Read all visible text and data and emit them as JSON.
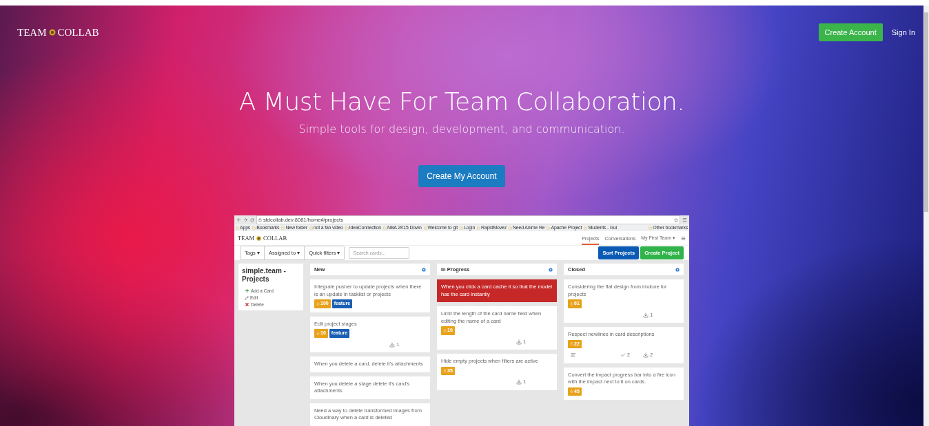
{
  "nav": {
    "logo_left": "TEAM",
    "logo_right": "COLLAB",
    "buttons": [
      {
        "label": "Create Account",
        "kind": "primary"
      },
      {
        "label": "Sign In",
        "kind": "link"
      }
    ]
  },
  "hero": {
    "title": "A Must Have For Team Collaboration.",
    "subtitle": "Simple tools for design, development, and communication.",
    "cta": "Create My Account"
  },
  "preview": {
    "url": "stdcollab.dev:8081/home#/projects",
    "bookmarks": [
      "Apps",
      "Bookmarks",
      "New folder",
      "not a fan video",
      "IdeaConnection",
      "NBA 2K15 Down",
      "Welcome to git",
      "Login",
      "RapidMovez",
      "Need Anime Re",
      "Apache Project",
      "Students - Gui"
    ],
    "other_bookmarks": "Other bookmarks",
    "app": {
      "logo_left": "TEAM",
      "logo_right": "COLLAB",
      "tabs": [
        {
          "label": "Projects",
          "selected": true
        },
        {
          "label": "Conversations",
          "selected": false
        },
        {
          "label": "My First Team ▾",
          "selected": false
        }
      ],
      "filters": [
        "Tags ▾",
        "Assigned to ▾",
        "Quick filters ▾"
      ],
      "search": {
        "placeholder": "Search cards..."
      },
      "buttons": [
        {
          "label": "Sort Projects",
          "kind": "primary"
        },
        {
          "label": "Create Project",
          "kind": "success"
        }
      ],
      "sidebar": {
        "title": "simple.team - Projects",
        "actions": [
          {
            "kind": "add",
            "label": "Add a Card"
          },
          {
            "kind": "edit",
            "label": "Edit"
          },
          {
            "kind": "delete",
            "label": "Delete"
          }
        ]
      },
      "columns": [
        {
          "title": "New",
          "cards": [
            {
              "text": "Integrate pusher to update projects when there is an update in tasklist or projects",
              "highlighted": false,
              "impact": "100",
              "tags": [
                "feature"
              ]
            },
            {
              "text": "Edit project stages",
              "highlighted": false,
              "impact": "10",
              "tags": [
                "feature"
              ],
              "attachments": "1"
            },
            {
              "text": "When you delete a card, delete it's attachments",
              "highlighted": false
            },
            {
              "text": "When you delete a stage delete it's card's attachments",
              "highlighted": false
            },
            {
              "text": "Need a way to delete transformed images from Cloudinary when a card is deleted",
              "highlighted": false
            }
          ]
        },
        {
          "title": "In Progress",
          "cards": [
            {
              "text": "When you click a card cache it so that the model has the card instantly",
              "highlighted": true
            },
            {
              "text": "Limit the length of the card name field when editing the name of a card",
              "highlighted": false,
              "impact": "10",
              "attachments": "1"
            },
            {
              "text": "Hide empty projects when filters are active",
              "highlighted": false,
              "impact": "35",
              "attachments": "1"
            }
          ]
        },
        {
          "title": "Closed",
          "cards": [
            {
              "text": "Considering the flat design from imdone for projects",
              "highlighted": false,
              "impact": "61",
              "attachments": "1"
            },
            {
              "text": "Respect newlines in card descriptions",
              "highlighted": false,
              "impact": "22",
              "has_description": true,
              "checks": "2",
              "attachments": "2"
            },
            {
              "text": "Convert the impact progress bar into a fire icon with the impact next to it on cards.",
              "highlighted": false,
              "impact": "45"
            }
          ]
        }
      ]
    }
  }
}
